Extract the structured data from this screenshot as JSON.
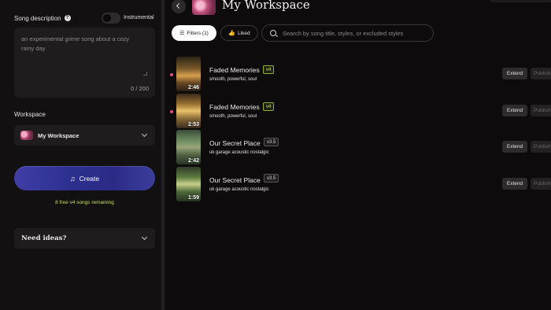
{
  "sidebar": {
    "description_label": "Song description",
    "instrumental_label": "Instrumental",
    "description_text": "an experimental grime song about a cozy rainy day",
    "char_count": "0 / 200",
    "workspace_label": "Workspace",
    "workspace_value": "My Workspace",
    "create_label": "Create",
    "free_songs_note": "8 free v4 songs remaining",
    "ideas_label": "Need ideas?"
  },
  "header": {
    "title": "My Workspace"
  },
  "toolbar": {
    "filters_label": "Filters (1)",
    "liked_label": "Liked",
    "search_placeholder": "Search by song title, styles, or excluded styles"
  },
  "songs": [
    {
      "title": "Faded Memories",
      "version": "v4",
      "styles": "smooth, powerful, soul",
      "duration": "2:46",
      "extend_label": "Extend",
      "publish_label": "Publish"
    },
    {
      "title": "Faded Memories",
      "version": "v4",
      "styles": "smooth, powerful, soul",
      "duration": "2:53",
      "extend_label": "Extend",
      "publish_label": "Publish"
    },
    {
      "title": "Our Secret Place",
      "version": "v3.5",
      "styles": "uk garage acoustic nostalgic",
      "duration": "2:42",
      "extend_label": "Extend",
      "publish_label": "Publish"
    },
    {
      "title": "Our Secret Place",
      "version": "v3.5",
      "styles": "uk garage acoustic nostalgic",
      "duration": "1:59",
      "extend_label": "Extend",
      "publish_label": "Publish"
    }
  ],
  "colors": {
    "background": "#0e0b0c",
    "accent_create": "#2d2f8f",
    "free_note": "#c4e062",
    "v4_badge": "#cbe36a",
    "unplayed_dot": "#d9547f"
  },
  "icons": {
    "help": "help-circle-icon",
    "back": "chevron-left-icon",
    "filter": "filter-icon",
    "like": "thumbs-up-icon",
    "search": "search-icon",
    "create": "music-note-icon",
    "dropdown": "chevron-down-icon"
  }
}
